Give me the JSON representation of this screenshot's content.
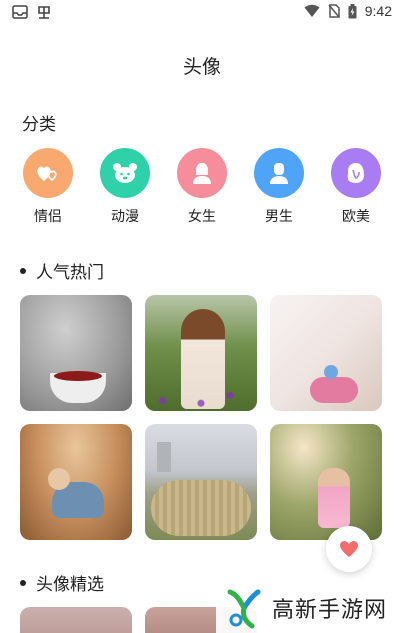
{
  "status_bar": {
    "time": "9:42",
    "left_icons": [
      "inbox-icon",
      "app-icon"
    ],
    "right_icons": [
      "wifi-icon",
      "no-sim-icon",
      "battery-charging-icon"
    ]
  },
  "header": {
    "title": "头像"
  },
  "categories": {
    "title": "分类",
    "items": [
      {
        "label": "情侣",
        "icon": "hearts-icon",
        "color": "#f9a870"
      },
      {
        "label": "动漫",
        "icon": "bear-icon",
        "color": "#2fd1a8"
      },
      {
        "label": "女生",
        "icon": "female-avatar-icon",
        "color": "#f58d9a"
      },
      {
        "label": "男生",
        "icon": "male-avatar-icon",
        "color": "#4fa4f7"
      },
      {
        "label": "欧美",
        "icon": "western-face-icon",
        "color": "#a97cf3"
      }
    ]
  },
  "popular": {
    "title": "人气热门",
    "thumbnails": [
      {
        "name": "sweater-coffee-cup-photo"
      },
      {
        "name": "girl-with-hat-in-field-photo"
      },
      {
        "name": "pink-toy-photo"
      },
      {
        "name": "baby-on-dirt-photo"
      },
      {
        "name": "child-on-hay-bale-photo"
      },
      {
        "name": "girl-in-pink-dress-photo"
      }
    ]
  },
  "featured": {
    "title": "头像精选"
  },
  "fab": {
    "icon": "heart-icon",
    "color": "#f26d6d"
  },
  "watermark": {
    "text": "高新手游网"
  }
}
